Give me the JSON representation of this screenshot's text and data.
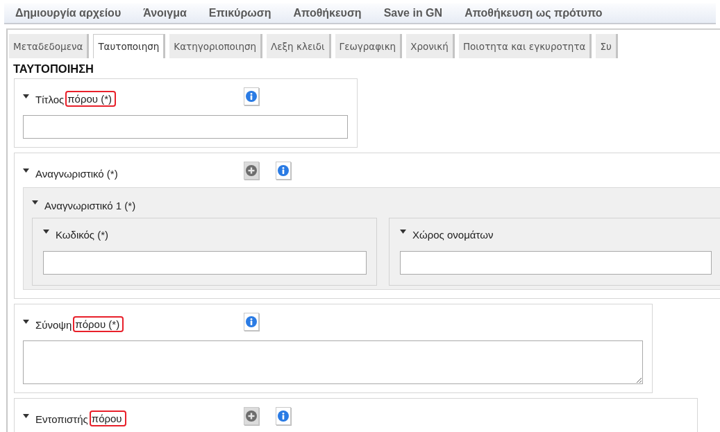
{
  "menu": [
    "Δημιουργία αρχείου",
    "Άνοιγμα",
    "Επικύρωση",
    "Αποθήκευση",
    "Save in GN",
    "Αποθήκευση ως πρότυπο"
  ],
  "tabs": [
    {
      "label": "Μεταδεδομενα",
      "selected": false
    },
    {
      "label": "Ταυτοποιηση",
      "selected": true
    },
    {
      "label": "Κατηγοριοποιηση",
      "selected": false
    },
    {
      "label": "Λεξη κλειδι",
      "selected": false
    },
    {
      "label": "Γεωγραφικη",
      "selected": false
    },
    {
      "label": "Χρονική",
      "selected": false
    },
    {
      "label": "Ποιοτητα και εγκυροτητα",
      "selected": false
    },
    {
      "label": "Συ",
      "selected": false
    }
  ],
  "heading": "ΤΑΥΤΟΠΟΙΗΣΗ",
  "sections": [
    {
      "kind": "field",
      "label": "Τίτλος",
      "highlight": "πόρου (*)",
      "buttons": [
        {
          "kind": "info"
        }
      ],
      "input": {
        "kind": "text"
      }
    },
    {
      "kind": "group",
      "label": "Αναγνωριστικό (*)",
      "buttons": [
        {
          "kind": "add"
        },
        {
          "kind": "info"
        }
      ],
      "children": [
        {
          "kind": "group",
          "label": "Αναγνωριστικό 1 (*)",
          "children": [
            {
              "kind": "field",
              "label": "Κωδικός (*)",
              "input": {
                "kind": "text"
              }
            },
            {
              "kind": "field",
              "label": "Χώρος ονομάτων",
              "input": {
                "kind": "text"
              }
            }
          ]
        }
      ]
    },
    {
      "kind": "field",
      "label": "Σύνοψη",
      "highlight": "πόρου (*)",
      "buttons": [
        {
          "kind": "info"
        }
      ],
      "input": {
        "kind": "textarea"
      }
    },
    {
      "kind": "field",
      "label": "Εντοπιστής",
      "highlight": "πόρου",
      "buttons": [
        {
          "kind": "add"
        },
        {
          "kind": "info"
        }
      ]
    }
  ]
}
